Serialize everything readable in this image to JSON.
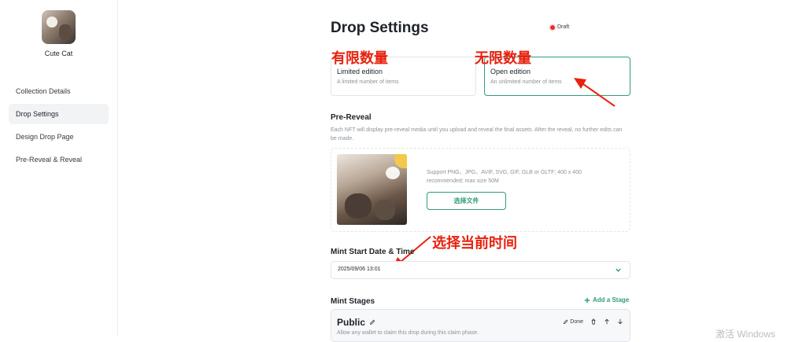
{
  "sidebar": {
    "collection_name": "Cute Cat",
    "items": [
      {
        "label": "Collection Details",
        "active": false
      },
      {
        "label": "Drop Settings",
        "active": true
      },
      {
        "label": "Design Drop Page",
        "active": false
      },
      {
        "label": "Pre-Reveal & Reveal",
        "active": false
      }
    ]
  },
  "header": {
    "title": "Drop Settings",
    "badge": "Draft"
  },
  "editions": [
    {
      "title": "Limited edition",
      "desc": "A limited number of items",
      "selected": false
    },
    {
      "title": "Open edition",
      "desc": "An unlimited number of items",
      "selected": true
    }
  ],
  "annotations": {
    "limited": "有限数量",
    "unlimited": "无限数量",
    "select_time": "选择当前时间",
    "color": "#e8210e"
  },
  "prereveal": {
    "title": "Pre-Reveal",
    "help": "Each NFT will display pre-reveal media until you upload and reveal the final assets. After the reveal, no further edits can be made.",
    "upload_info": "Support PNG、JPG、AVIF, SVG, GIF, GLB or GLTF; 400 x 400 recommended; max size 50M",
    "upload_button": "选择文件"
  },
  "mint_start": {
    "title": "Mint Start Date & Time",
    "value": "2025/09/06 13:01"
  },
  "mint_stages": {
    "title": "Mint Stages",
    "add_label": "Add a Stage",
    "stage": {
      "name": "Public",
      "desc": "Allow any wallet to claim this drop during this claim phase.",
      "done_label": "Done"
    }
  },
  "watermark": "激活 Windows",
  "colors": {
    "accent": "#2f9e78",
    "badge": "#e03131"
  },
  "icons": [
    "pencil-icon",
    "trash-icon",
    "arrow-up-icon",
    "arrow-down-icon",
    "chevron-down-icon",
    "plus-icon"
  ]
}
